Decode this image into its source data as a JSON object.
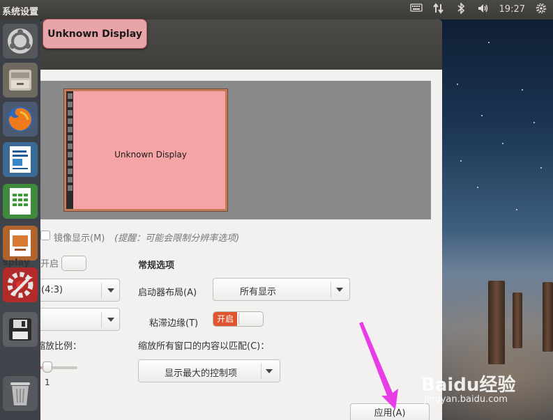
{
  "top_panel": {
    "app_title": "系统设置",
    "clock": "19:27",
    "tray_icons": [
      "keyboard-icon",
      "network-icon",
      "bluetooth-icon",
      "volume-icon",
      "settings-gear-icon"
    ]
  },
  "launcher": {
    "items": [
      "ubuntu-dash-icon",
      "files-icon",
      "firefox-icon",
      "writer-icon",
      "calc-icon",
      "impress-icon",
      "system-settings-icon",
      "save-drive-icon",
      "trash-icon"
    ]
  },
  "tooltip": {
    "text": "Unknown Display"
  },
  "preview": {
    "monitor_label": "Unknown Display"
  },
  "options": {
    "mirror_label": "镜像显示(M)",
    "mirror_hint": "(提醒：可能会限制分辨率选项)",
    "display_left_label": "splay",
    "display_switch_label": "开启",
    "resolution_value": "(4:3)",
    "general_heading": "常规选项",
    "launcher_placement_label": "启动器布局(A)",
    "launcher_placement_value": "所有显示",
    "sticky_edges_label": "粘滞边缘(T)",
    "sticky_edges_switch": "开启",
    "scale_left_label": "缩放比例：",
    "scale_value": "1",
    "scale_all_label": "缩放所有窗口的内容以匹配(C)：",
    "scale_all_value": "显示最大的控制项",
    "apply_button": "应用(A)"
  },
  "watermark": {
    "brand": "Baidu经验",
    "url": "jingyan.baidu.com"
  },
  "colors": {
    "accent": "#e0542f",
    "tooltip_bg": "#e8a4a6",
    "monitor_bg": "#f7a4a6",
    "arrow": "#e83de6"
  }
}
